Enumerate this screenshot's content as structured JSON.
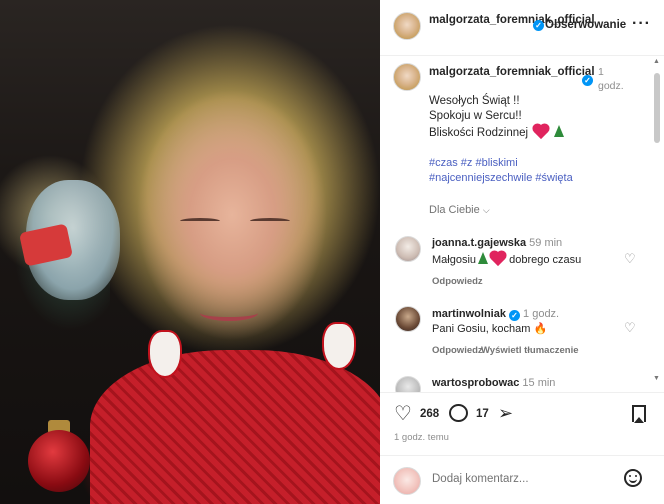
{
  "header": {
    "username": "malgorzata_foremniak_official",
    "follow_label": "Obserwowanie",
    "more_icon": "more-horizontal-icon"
  },
  "caption": {
    "username": "malgorzata_foremniak_official",
    "time": "1 godz.",
    "lines": [
      "Wesołych Świąt !!",
      "Spokoju w Sercu!!",
      "Bliskości Rodzinnej"
    ],
    "hashtags_line1": "#czas #z #bliskimi",
    "hashtags_line2": "#najcenniejszechwile #święta"
  },
  "sort_label": "Dla Ciebie",
  "comments": [
    {
      "username": "joanna.t.gajewska",
      "time": "59 min",
      "text_before": "Małgosiu",
      "text_after": "dobrego czasu",
      "reply": "Odpowiedz"
    },
    {
      "username": "martinwolniak",
      "time": "1 godz.",
      "text": "Pani Gosiu, kocham",
      "reply": "Odpowiedz",
      "translate": "Wyświetl tłumaczenie"
    },
    {
      "username": "wartosprobowac",
      "time": "15 min"
    }
  ],
  "actions": {
    "likes": "268",
    "comments": "17",
    "posted": "1 godz. temu"
  },
  "add_comment": {
    "placeholder": "Dodaj komentarz..."
  },
  "colors": {
    "verified": "#0095f6",
    "hashtag": "#4a5fc1",
    "heart": "#e0245e",
    "tree": "#2e8b3a"
  }
}
